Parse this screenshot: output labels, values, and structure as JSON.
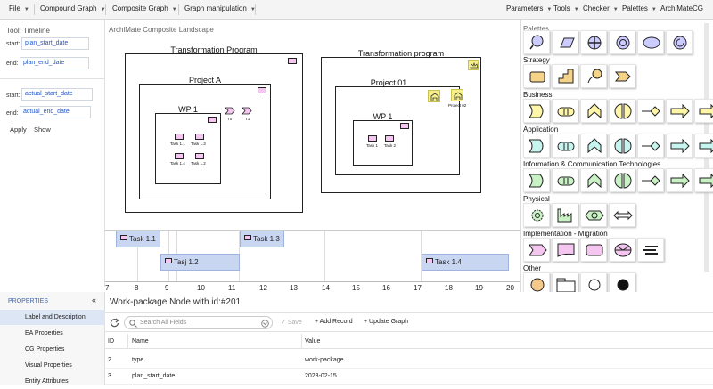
{
  "menubar": {
    "left": [
      {
        "label": "File"
      },
      {
        "label": "Compound Graph"
      },
      {
        "label": "Composite Graph"
      },
      {
        "label": "Graph manipulation"
      }
    ],
    "right": [
      {
        "label": "Parameters"
      },
      {
        "label": "Tools"
      },
      {
        "label": "Checker"
      },
      {
        "label": "Palettes"
      },
      {
        "label": "ArchiMateCG"
      }
    ]
  },
  "tool": {
    "title": "Tool: Timeline",
    "start_label": "start:",
    "end_label": "end:",
    "plan_start": "plan_start_date",
    "plan_end": "plan_end_date",
    "actual_start": "actual_start_date",
    "actual_end": "actual_end_date",
    "apply": "Apply",
    "show": "Show"
  },
  "canvas": {
    "title": "ArchiMate Composite Landscape",
    "left": {
      "outer": "Transformation Program",
      "project": "Project A",
      "wp": "WP 1",
      "tasks": [
        "Task 1.1",
        "Task 1.3",
        "Task 1.4",
        "Task 1.2"
      ],
      "milestones": [
        "T0",
        "T1"
      ]
    },
    "right": {
      "outer": "Transformation program",
      "project": "Project 01",
      "project2": "Project 02",
      "wp": "WP 1",
      "tasks": [
        "Task 1",
        "Task 2"
      ]
    }
  },
  "palette": {
    "title": "Palettes",
    "sections": [
      "Strategy",
      "Business",
      "Application",
      "Information & Communication Technologies",
      "Physical",
      "Implementation - Migration",
      "Other"
    ]
  },
  "timeline": {
    "bars": [
      {
        "label": "Task 1.1"
      },
      {
        "label": "Tasj 1.2"
      },
      {
        "label": "Task 1.3"
      },
      {
        "label": "Task 1.4"
      }
    ],
    "ticks": [
      "7",
      "8",
      "9",
      "10",
      "11",
      "12",
      "13",
      "14",
      "15",
      "16",
      "17",
      "18",
      "19",
      "20"
    ]
  },
  "properties": {
    "header": "PROPERTIES",
    "collapse": "«",
    "items": [
      "Label and Description",
      "EA Properties",
      "CG Properties",
      "Visual Properties",
      "Entity Attributes"
    ]
  },
  "details": {
    "title": "Work-package Node with id:#201",
    "search_placeholder": "Search All Fields",
    "save": "Save",
    "add_record": "Add Record",
    "update_graph": "Update Graph",
    "columns": [
      "ID",
      "Name",
      "Value"
    ],
    "rows": [
      {
        "id": "2",
        "name": "type",
        "value": "work-package"
      },
      {
        "id": "3",
        "name": "plan_start_date",
        "value": "2023-02-15"
      }
    ]
  }
}
